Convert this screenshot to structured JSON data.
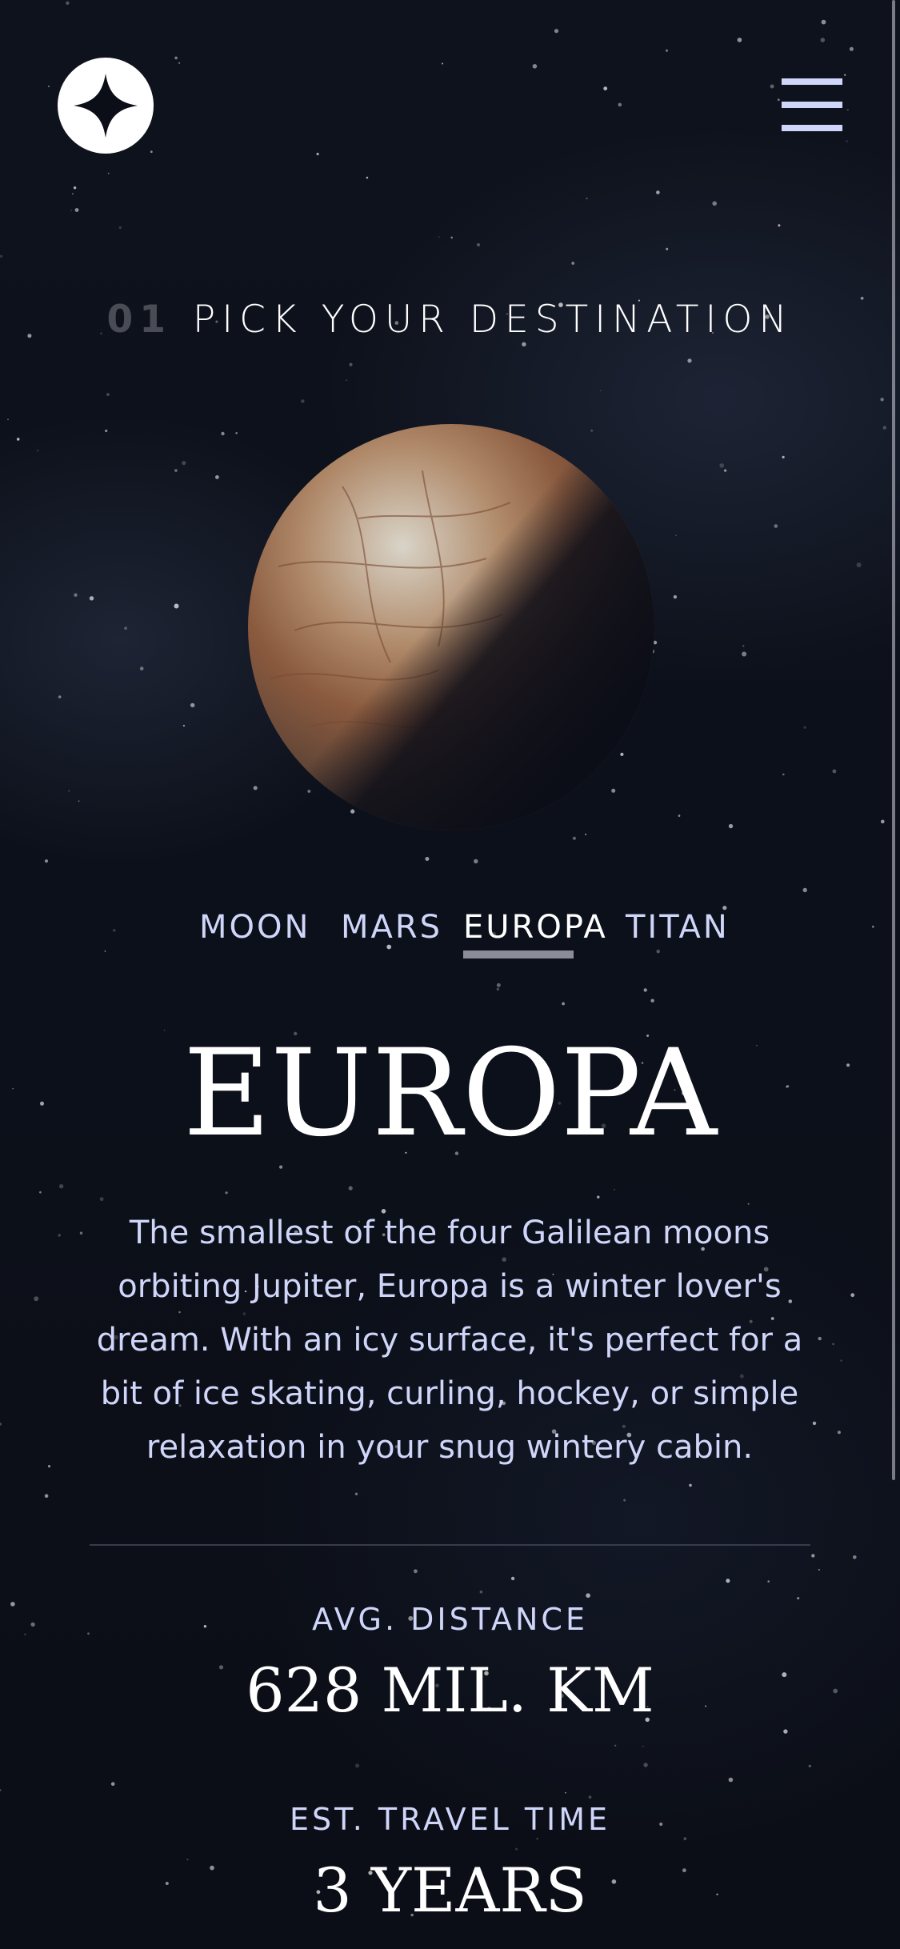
{
  "header": {
    "logo_icon": "star-logo-icon",
    "menu_icon": "hamburger-menu-icon"
  },
  "heading": {
    "number": "01",
    "text": "PICK YOUR DESTINATION"
  },
  "destination_tabs": [
    {
      "label": "MOON",
      "active": false
    },
    {
      "label": "MARS",
      "active": false
    },
    {
      "label": "EUROPA",
      "active": true
    },
    {
      "label": "TITAN",
      "active": false
    }
  ],
  "destination": {
    "name": "EUROPA",
    "description": "The smallest of the four Galilean moons orbiting Jupiter, Europa is a winter lover's dream. With an icy surface, it's perfect for a bit of ice skating, curling, hockey, or simple relaxation in your snug wintery cabin.",
    "avg_distance_label": "AVG. DISTANCE",
    "avg_distance_value": "628 MIL. KM",
    "travel_time_label": "EST. TRAVEL TIME",
    "travel_time_value": "3 YEARS"
  },
  "colors": {
    "background": "#0b0d17",
    "accent_light": "#d0d6f9",
    "white": "#ffffff",
    "active_underline": "#8a8d98"
  }
}
